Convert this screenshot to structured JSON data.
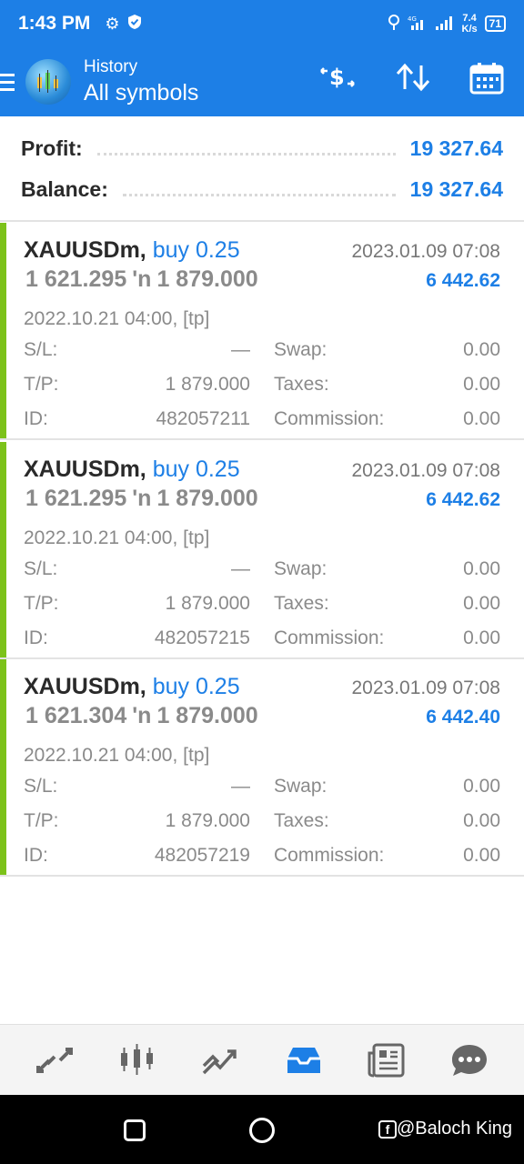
{
  "status_bar": {
    "time": "1:43 PM",
    "left_icons": [
      "gear-icon",
      "shield-check-icon"
    ],
    "right_icons": [
      "alarm-icon",
      "signal-4g-icon",
      "signal-icon"
    ],
    "network_speed": "7.4",
    "network_unit": "K/s",
    "battery": "71"
  },
  "app_bar": {
    "subtitle": "History",
    "title": "All symbols",
    "actions": [
      "currency-exchange-icon",
      "sort-icon",
      "calendar-icon"
    ]
  },
  "summary": {
    "profit_label": "Profit:",
    "profit_value": "19 327.64",
    "balance_label": "Balance:",
    "balance_value": "19 327.64"
  },
  "deals": [
    {
      "symbol": "XAUUSDm,",
      "type": "buy 0.25",
      "close_time": "2023.01.09 07:08",
      "open_price": "1 621.295",
      "arrow": "'n",
      "close_price": "1 879.000",
      "profit": "6 442.62",
      "open_time": "2022.10.21 04:00, [tp]",
      "sl_label": "S/L:",
      "sl_value": "—",
      "swap_label": "Swap:",
      "swap_value": "0.00",
      "tp_label": "T/P:",
      "tp_value": "1 879.000",
      "taxes_label": "Taxes:",
      "taxes_value": "0.00",
      "id_label": "ID:",
      "id_value": "482057211",
      "commission_label": "Commission:",
      "commission_value": "0.00"
    },
    {
      "symbol": "XAUUSDm,",
      "type": "buy 0.25",
      "close_time": "2023.01.09 07:08",
      "open_price": "1 621.295",
      "arrow": "'n",
      "close_price": "1 879.000",
      "profit": "6 442.62",
      "open_time": "2022.10.21 04:00, [tp]",
      "sl_label": "S/L:",
      "sl_value": "—",
      "swap_label": "Swap:",
      "swap_value": "0.00",
      "tp_label": "T/P:",
      "tp_value": "1 879.000",
      "taxes_label": "Taxes:",
      "taxes_value": "0.00",
      "id_label": "ID:",
      "id_value": "482057215",
      "commission_label": "Commission:",
      "commission_value": "0.00"
    },
    {
      "symbol": "XAUUSDm,",
      "type": "buy 0.25",
      "close_time": "2023.01.09 07:08",
      "open_price": "1 621.304",
      "arrow": "'n",
      "close_price": "1 879.000",
      "profit": "6 442.40",
      "open_time": "2022.10.21 04:00, [tp]",
      "sl_label": "S/L:",
      "sl_value": "—",
      "swap_label": "Swap:",
      "swap_value": "0.00",
      "tp_label": "T/P:",
      "tp_value": "1 879.000",
      "taxes_label": "Taxes:",
      "taxes_value": "0.00",
      "id_label": "ID:",
      "id_value": "482057219",
      "commission_label": "Commission:",
      "commission_value": "0.00"
    }
  ],
  "bottom_nav": {
    "items": [
      "quotes-icon",
      "chart-icon",
      "trade-icon",
      "history-icon",
      "news-icon",
      "chat-icon"
    ],
    "active": "history-icon"
  },
  "system_nav": {
    "watermark": "@Baloch King"
  },
  "colors": {
    "accent": "#1d7fe6",
    "buy_bar": "#7cc21a",
    "muted_text": "#8a8a8a"
  }
}
